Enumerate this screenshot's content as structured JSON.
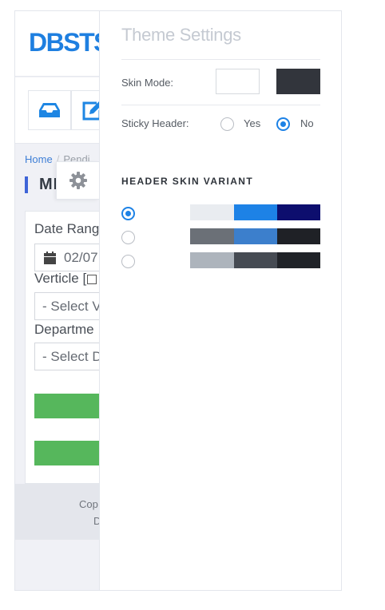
{
  "page": {
    "brand": "DBSTS",
    "breadcrumb": {
      "home": "Home",
      "separator": "/",
      "current": "Pendi"
    },
    "title": "MI",
    "form": {
      "date_label": "Date Rang",
      "date_value": "02/07",
      "verticle_label": "Verticle [",
      "verticle_placeholder": "- Select V",
      "department_label": "Departme",
      "department_placeholder": "- Select D"
    },
    "footer": {
      "line1": "Cop",
      "line2": "D"
    },
    "icons": {
      "inbox": "inbox-icon",
      "edit": "edit-icon",
      "settings": "gear-icon",
      "calendar": "calendar-icon"
    }
  },
  "theme_settings": {
    "title": "Theme Settings",
    "skin_mode_label": "Skin Mode:",
    "skin_colors": [
      "#ffffff",
      "#32353c"
    ],
    "sticky_header_label": "Sticky Header:",
    "sticky_options": [
      "Yes",
      "No"
    ],
    "sticky_selected": "No",
    "header_skin_title": "HEADER SKIN VARIANT",
    "variants": [
      {
        "selected": true,
        "colors": [
          "#ffffff",
          "#e9ecf0",
          "#1d82e6",
          "#0d0e6e"
        ]
      },
      {
        "selected": false,
        "colors": [
          "#ffffff",
          "#6b7077",
          "#3c7fcc",
          "#1f2126"
        ]
      },
      {
        "selected": false,
        "colors": [
          "#ffffff",
          "#adb4bc",
          "#464b53",
          "#202328"
        ]
      }
    ]
  },
  "colors": {
    "accent": "#1d82e6",
    "brand": "#1e7fe0",
    "success": "#56b75c"
  }
}
